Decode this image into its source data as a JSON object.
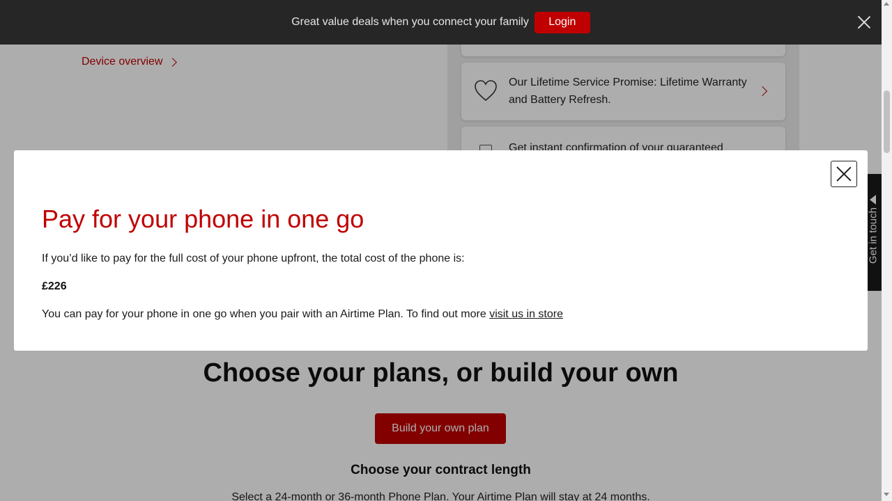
{
  "banner": {
    "text": "Great value deals when you connect your family",
    "login_label": "Login"
  },
  "background": {
    "device_overview_link": "Device overview",
    "cards": [
      {
        "text": "Our Lifetime Service Promise: Lifetime Warranty and Battery Refresh.",
        "icon": "heart-icon"
      },
      {
        "text": "Get instant confirmation of your guaranteed",
        "icon": "document-icon"
      }
    ],
    "get_in_touch": "Get in touch",
    "plans_heading": "Choose your plans, or build your own",
    "build_button": "Build your own plan",
    "contract_heading": "Choose your contract length",
    "contract_sub": "Select a 24-month or 36-month Phone Plan. Your Airtime Plan will stay at 24 months."
  },
  "modal": {
    "title": "Pay for your phone in one go",
    "line1": "If you’d like to pay for the full cost of your phone upfront, the total cost of the phone is:",
    "price": "£226",
    "line2_prefix": "You can pay for your phone in one go when you pair with an Airtime Plan. To find out more ",
    "line2_link": "visit us in store"
  },
  "colors": {
    "brand_red": "#c00000",
    "banner_bg": "#262626"
  }
}
